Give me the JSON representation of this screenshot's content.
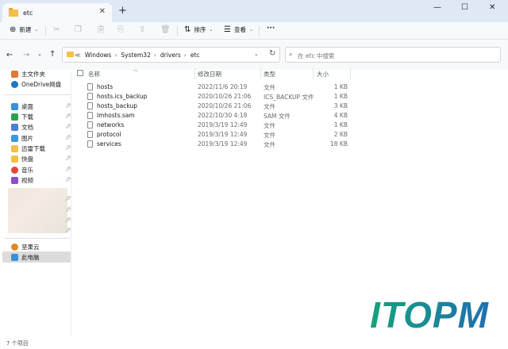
{
  "window": {
    "tab_title": "etc",
    "tab_close": "✕",
    "new_tab": "+",
    "controls": {
      "minimize": "—",
      "maximize": "☐",
      "close": "✕"
    }
  },
  "toolbar": {
    "new_label": "新建",
    "sort_label": "排序",
    "view_label": "查看",
    "more_label": "···"
  },
  "address": {
    "crumbs": [
      "≪",
      "Windows",
      "System32",
      "drivers",
      "etc"
    ],
    "search_placeholder": "在 etc 中搜索"
  },
  "sidebar": {
    "top_items": [
      {
        "label": "主文件夹",
        "icon": "home-icon",
        "color": "#e07a3a"
      },
      {
        "label": "OneDrive网盘",
        "icon": "cloud-icon",
        "color": "#1e73c8"
      }
    ],
    "quick_items": [
      {
        "label": "桌面",
        "icon": "desktop-icon",
        "color": "#3a8fd6"
      },
      {
        "label": "下载",
        "icon": "download-icon",
        "color": "#2fa14f"
      },
      {
        "label": "文档",
        "icon": "document-icon",
        "color": "#4d7fd1"
      },
      {
        "label": "图片",
        "icon": "picture-icon",
        "color": "#3a9bd6"
      },
      {
        "label": "迅雷下载",
        "icon": "folder-icon",
        "color": "#f3c04b"
      },
      {
        "label": "快盘",
        "icon": "folder-icon",
        "color": "#f3c04b"
      },
      {
        "label": "音乐",
        "icon": "music-icon",
        "color": "#e0483d"
      },
      {
        "label": "视频",
        "icon": "video-icon",
        "color": "#8a4fc9"
      }
    ],
    "bottom_items": [
      {
        "label": "坚果云",
        "icon": "nutstore-icon",
        "color": "#d98a2b"
      },
      {
        "label": "此电脑",
        "icon": "computer-icon",
        "color": "#3a8fd6"
      }
    ]
  },
  "columns": {
    "name": "名称",
    "date": "修改日期",
    "type": "类型",
    "size": "大小"
  },
  "files": [
    {
      "name": "hosts",
      "date": "2022/11/6 20:19",
      "type": "文件",
      "size": "1 KB"
    },
    {
      "name": "hosts.ics_backup",
      "date": "2020/10/26 21:06",
      "type": "ICS_BACKUP 文件",
      "size": "1 KB"
    },
    {
      "name": "hosts_backup",
      "date": "2020/10/26 21:06",
      "type": "文件",
      "size": "3 KB"
    },
    {
      "name": "lmhosts.sam",
      "date": "2022/10/30 4:18",
      "type": "SAM 文件",
      "size": "4 KB"
    },
    {
      "name": "networks",
      "date": "2019/3/19 12:49",
      "type": "文件",
      "size": "1 KB"
    },
    {
      "name": "protocol",
      "date": "2019/3/19 12:49",
      "type": "文件",
      "size": "2 KB"
    },
    {
      "name": "services",
      "date": "2019/3/19 12:49",
      "type": "文件",
      "size": "18 KB"
    }
  ],
  "status": {
    "item_count": "7 个项目"
  },
  "watermark": {
    "text": "ITOPM"
  }
}
